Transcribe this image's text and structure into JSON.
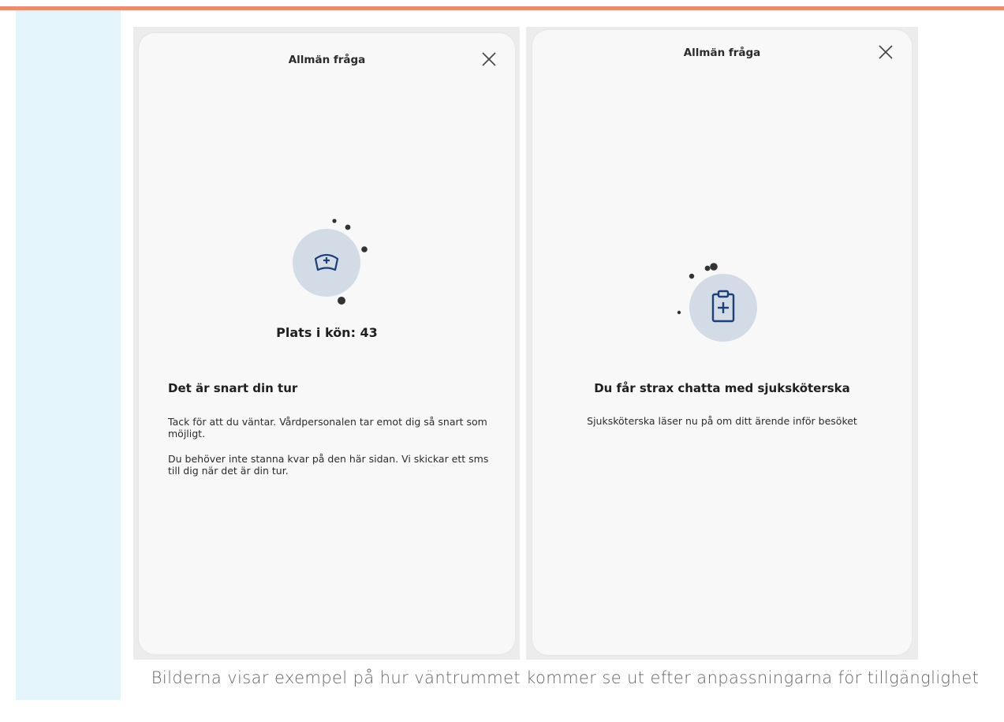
{
  "left_panel": {
    "title": "Allmän fråga",
    "close_icon": "close-icon",
    "icon": "nurse-cap-icon",
    "queue_text": "Plats i kön: 43",
    "heading": "Det är snart din tur",
    "paragraph_1": "Tack för att du väntar. Vårdpersonalen tar emot dig så snart som möjligt.",
    "paragraph_2": "Du behöver inte stanna kvar på den här sidan. Vi skickar ett sms till dig när det är din tur."
  },
  "right_panel": {
    "title": "Allmän fråga",
    "close_icon": "close-icon",
    "icon": "clipboard-plus-icon",
    "heading": "Du får strax chatta med sjuksköterska",
    "subtext": "Sjuksköterska läser nu på om ditt ärende inför besöket"
  },
  "caption": "Bilderna visar exempel på hur väntrummet kommer se ut efter anpassningarna för tillgänglighet",
  "colors": {
    "accent_bar": "#ef8a6f",
    "side_rail": "#e3f5fa",
    "icon_circle": "#d3dce6",
    "icon_stroke": "#1c3f7a",
    "dots": "#333333"
  }
}
